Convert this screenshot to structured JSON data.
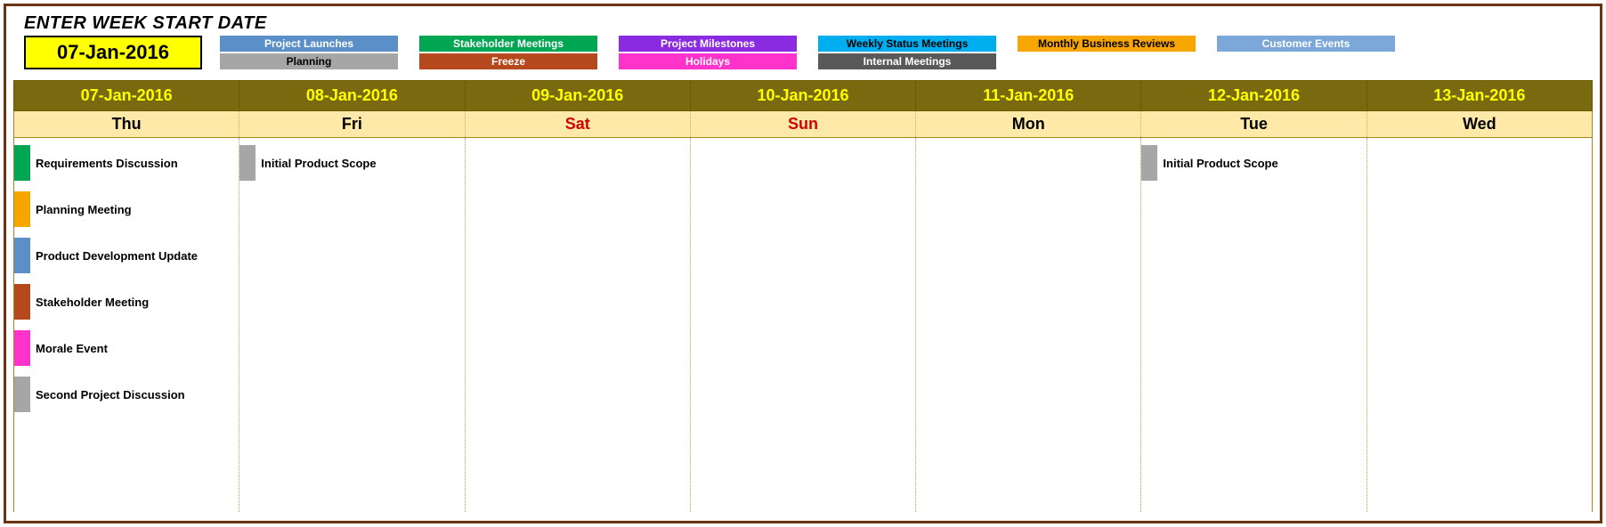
{
  "header": {
    "title": "ENTER WEEK START DATE",
    "start_date": "07-Jan-2016"
  },
  "legend": {
    "row1": [
      {
        "label": "Project Launches",
        "bg": "#5a8fc8",
        "fg": "#ffffff"
      },
      {
        "label": "Stakeholder Meetings",
        "bg": "#00a651",
        "fg": "#ffffff"
      },
      {
        "label": "Project Milestones",
        "bg": "#8a2be2",
        "fg": "#ffffff"
      },
      {
        "label": "Weekly Status Meetings",
        "bg": "#00aeef",
        "fg": "#000000"
      },
      {
        "label": "Monthly Business Reviews",
        "bg": "#f7a600",
        "fg": "#000000"
      },
      {
        "label": "Customer Events",
        "bg": "#7ba7d9",
        "fg": "#ffffff"
      }
    ],
    "row2": [
      {
        "label": "Planning",
        "bg": "#a6a6a6",
        "fg": "#000000"
      },
      {
        "label": "Freeze",
        "bg": "#b5481d",
        "fg": "#ffffff"
      },
      {
        "label": "Holidays",
        "bg": "#ff33cc",
        "fg": "#ffffff"
      },
      {
        "label": "Internal Meetings",
        "bg": "#595959",
        "fg": "#ffffff"
      }
    ]
  },
  "dates": [
    "07-Jan-2016",
    "08-Jan-2016",
    "09-Jan-2016",
    "10-Jan-2016",
    "11-Jan-2016",
    "12-Jan-2016",
    "13-Jan-2016"
  ],
  "days": [
    {
      "label": "Thu",
      "weekend": false
    },
    {
      "label": "Fri",
      "weekend": false
    },
    {
      "label": "Sat",
      "weekend": true
    },
    {
      "label": "Sun",
      "weekend": true
    },
    {
      "label": "Mon",
      "weekend": false
    },
    {
      "label": "Tue",
      "weekend": false
    },
    {
      "label": "Wed",
      "weekend": false
    }
  ],
  "columns": [
    [
      {
        "label": "Requirements Discussion",
        "color": "#00a651"
      },
      {
        "label": "Planning Meeting",
        "color": "#f7a600"
      },
      {
        "label": "Product Development Update",
        "color": "#5a8fc8"
      },
      {
        "label": "Stakeholder Meeting",
        "color": "#b5481d"
      },
      {
        "label": "Morale Event",
        "color": "#ff33cc"
      },
      {
        "label": "Second Project Discussion",
        "color": "#a6a6a6"
      }
    ],
    [
      {
        "label": "Initial Product Scope",
        "color": "#a6a6a6"
      }
    ],
    [],
    [],
    [],
    [
      {
        "label": "Initial Product Scope",
        "color": "#a6a6a6"
      }
    ],
    []
  ]
}
